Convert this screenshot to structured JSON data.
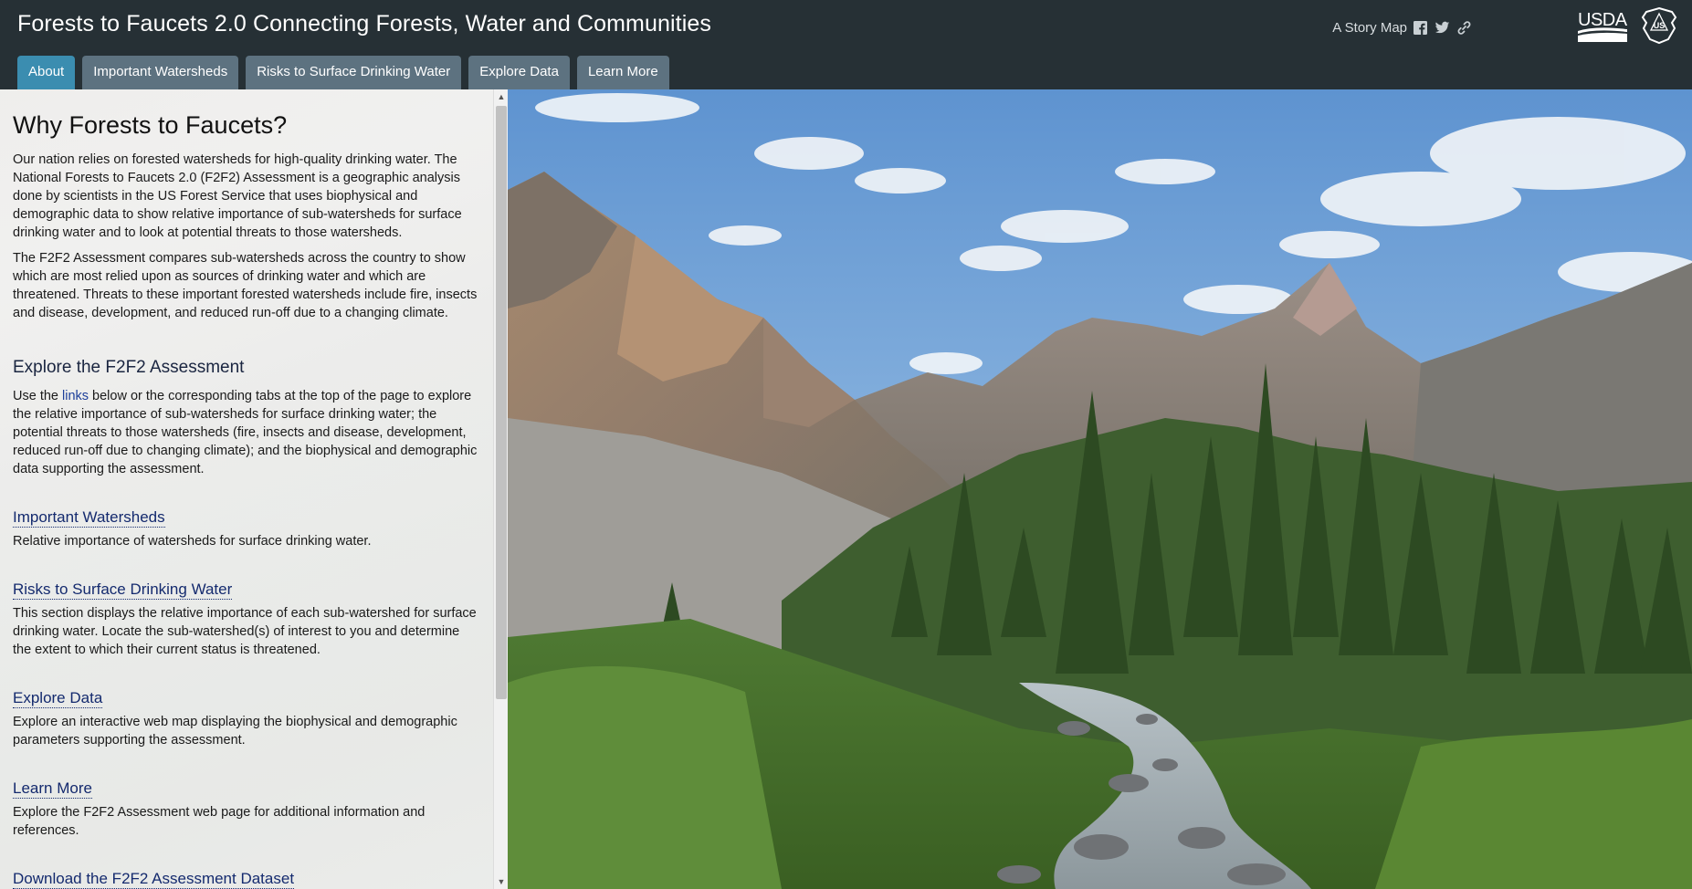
{
  "header": {
    "title": "Forests to Faucets 2.0 Connecting Forests, Water and Communities",
    "story_map_label": "A Story Map",
    "icons": [
      "facebook-icon",
      "twitter-icon",
      "link-icon"
    ],
    "logos": {
      "usda": "USDA",
      "usfs": "US"
    }
  },
  "tabs": [
    {
      "label": "About",
      "active": true
    },
    {
      "label": "Important Watersheds",
      "active": false
    },
    {
      "label": "Risks to Surface Drinking Water",
      "active": false
    },
    {
      "label": "Explore Data",
      "active": false
    },
    {
      "label": "Learn More",
      "active": false
    }
  ],
  "panel": {
    "heading": "Why Forests to Faucets?",
    "intro_p1": "Our nation relies on forested watersheds for high-quality drinking water. The National Forests to Faucets 2.0 (F2F2) Assessment is a geographic analysis done by scientists in the US Forest Service that uses biophysical and demographic data to show relative importance of sub-watersheds for surface drinking water and to look at potential threats to those watersheds.",
    "intro_p2": "The F2F2 Assessment compares sub-watersheds across the country to show which are most relied upon as sources of drinking water and which are threatened. Threats to these important forested watersheds include fire, insects and disease, development, and reduced run-off due to a changing climate.",
    "explore_heading": "Explore the F2F2 Assessment",
    "explore_text_before": "Use the ",
    "explore_link": "links",
    "explore_text_after": " below or the corresponding tabs at the top of the page to explore the relative importance of sub-watersheds for surface drinking water; the potential threats to those watersheds (fire, insects and disease, development, reduced run-off due to changing climate); and the biophysical and demographic data supporting the assessment.",
    "sections": [
      {
        "title": "Important Watersheds",
        "text": "Relative importance of watersheds for surface drinking water."
      },
      {
        "title": "Risks to Surface Drinking Water",
        "text": "This section displays the relative importance of each sub-watershed for surface drinking water. Locate the sub-watershed(s) of interest to you and determine the extent to which their current status is threatened."
      },
      {
        "title": "Explore Data",
        "text": "Explore an interactive web map displaying the biophysical and demographic parameters supporting the assessment."
      },
      {
        "title": "Learn More",
        "text": "Explore the F2F2 Assessment web page for additional information and references."
      },
      {
        "title": "Download the F2F2 Assessment Dataset",
        "text": ""
      }
    ]
  },
  "colors": {
    "header_bg": "#263035",
    "tab_bg": "#5d7280",
    "tab_active_bg": "#3b8db0",
    "link": "#142a6e"
  }
}
